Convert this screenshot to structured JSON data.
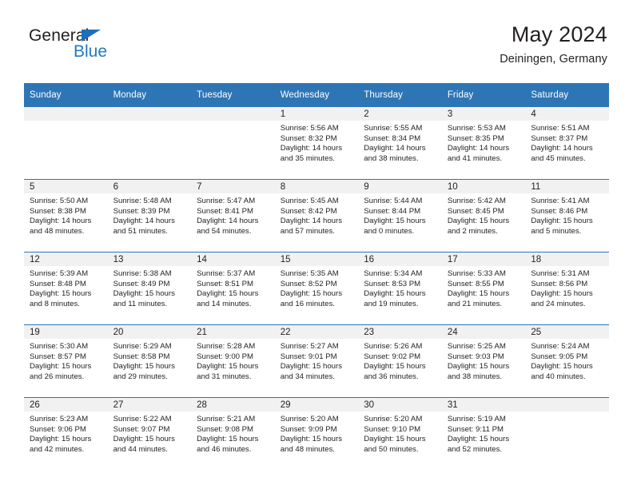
{
  "brand": {
    "name_part1": "General",
    "name_part2": "Blue",
    "accent_color": "#1f7ac0"
  },
  "header": {
    "title": "May 2024",
    "subtitle": "Deiningen, Germany"
  },
  "theme": {
    "header_blue": "#2e75b6",
    "daynum_band": "#f1f1f1",
    "text": "#231f20"
  },
  "weekday_headers": [
    "Sunday",
    "Monday",
    "Tuesday",
    "Wednesday",
    "Thursday",
    "Friday",
    "Saturday"
  ],
  "weeks": [
    [
      {
        "day": "",
        "sunrise": "",
        "sunset": "",
        "daylight_line1": "",
        "daylight_line2": ""
      },
      {
        "day": "",
        "sunrise": "",
        "sunset": "",
        "daylight_line1": "",
        "daylight_line2": ""
      },
      {
        "day": "",
        "sunrise": "",
        "sunset": "",
        "daylight_line1": "",
        "daylight_line2": ""
      },
      {
        "day": "1",
        "sunrise": "Sunrise: 5:56 AM",
        "sunset": "Sunset: 8:32 PM",
        "daylight_line1": "Daylight: 14 hours",
        "daylight_line2": "and 35 minutes."
      },
      {
        "day": "2",
        "sunrise": "Sunrise: 5:55 AM",
        "sunset": "Sunset: 8:34 PM",
        "daylight_line1": "Daylight: 14 hours",
        "daylight_line2": "and 38 minutes."
      },
      {
        "day": "3",
        "sunrise": "Sunrise: 5:53 AM",
        "sunset": "Sunset: 8:35 PM",
        "daylight_line1": "Daylight: 14 hours",
        "daylight_line2": "and 41 minutes."
      },
      {
        "day": "4",
        "sunrise": "Sunrise: 5:51 AM",
        "sunset": "Sunset: 8:37 PM",
        "daylight_line1": "Daylight: 14 hours",
        "daylight_line2": "and 45 minutes."
      }
    ],
    [
      {
        "day": "5",
        "sunrise": "Sunrise: 5:50 AM",
        "sunset": "Sunset: 8:38 PM",
        "daylight_line1": "Daylight: 14 hours",
        "daylight_line2": "and 48 minutes."
      },
      {
        "day": "6",
        "sunrise": "Sunrise: 5:48 AM",
        "sunset": "Sunset: 8:39 PM",
        "daylight_line1": "Daylight: 14 hours",
        "daylight_line2": "and 51 minutes."
      },
      {
        "day": "7",
        "sunrise": "Sunrise: 5:47 AM",
        "sunset": "Sunset: 8:41 PM",
        "daylight_line1": "Daylight: 14 hours",
        "daylight_line2": "and 54 minutes."
      },
      {
        "day": "8",
        "sunrise": "Sunrise: 5:45 AM",
        "sunset": "Sunset: 8:42 PM",
        "daylight_line1": "Daylight: 14 hours",
        "daylight_line2": "and 57 minutes."
      },
      {
        "day": "9",
        "sunrise": "Sunrise: 5:44 AM",
        "sunset": "Sunset: 8:44 PM",
        "daylight_line1": "Daylight: 15 hours",
        "daylight_line2": "and 0 minutes."
      },
      {
        "day": "10",
        "sunrise": "Sunrise: 5:42 AM",
        "sunset": "Sunset: 8:45 PM",
        "daylight_line1": "Daylight: 15 hours",
        "daylight_line2": "and 2 minutes."
      },
      {
        "day": "11",
        "sunrise": "Sunrise: 5:41 AM",
        "sunset": "Sunset: 8:46 PM",
        "daylight_line1": "Daylight: 15 hours",
        "daylight_line2": "and 5 minutes."
      }
    ],
    [
      {
        "day": "12",
        "sunrise": "Sunrise: 5:39 AM",
        "sunset": "Sunset: 8:48 PM",
        "daylight_line1": "Daylight: 15 hours",
        "daylight_line2": "and 8 minutes."
      },
      {
        "day": "13",
        "sunrise": "Sunrise: 5:38 AM",
        "sunset": "Sunset: 8:49 PM",
        "daylight_line1": "Daylight: 15 hours",
        "daylight_line2": "and 11 minutes."
      },
      {
        "day": "14",
        "sunrise": "Sunrise: 5:37 AM",
        "sunset": "Sunset: 8:51 PM",
        "daylight_line1": "Daylight: 15 hours",
        "daylight_line2": "and 14 minutes."
      },
      {
        "day": "15",
        "sunrise": "Sunrise: 5:35 AM",
        "sunset": "Sunset: 8:52 PM",
        "daylight_line1": "Daylight: 15 hours",
        "daylight_line2": "and 16 minutes."
      },
      {
        "day": "16",
        "sunrise": "Sunrise: 5:34 AM",
        "sunset": "Sunset: 8:53 PM",
        "daylight_line1": "Daylight: 15 hours",
        "daylight_line2": "and 19 minutes."
      },
      {
        "day": "17",
        "sunrise": "Sunrise: 5:33 AM",
        "sunset": "Sunset: 8:55 PM",
        "daylight_line1": "Daylight: 15 hours",
        "daylight_line2": "and 21 minutes."
      },
      {
        "day": "18",
        "sunrise": "Sunrise: 5:31 AM",
        "sunset": "Sunset: 8:56 PM",
        "daylight_line1": "Daylight: 15 hours",
        "daylight_line2": "and 24 minutes."
      }
    ],
    [
      {
        "day": "19",
        "sunrise": "Sunrise: 5:30 AM",
        "sunset": "Sunset: 8:57 PM",
        "daylight_line1": "Daylight: 15 hours",
        "daylight_line2": "and 26 minutes."
      },
      {
        "day": "20",
        "sunrise": "Sunrise: 5:29 AM",
        "sunset": "Sunset: 8:58 PM",
        "daylight_line1": "Daylight: 15 hours",
        "daylight_line2": "and 29 minutes."
      },
      {
        "day": "21",
        "sunrise": "Sunrise: 5:28 AM",
        "sunset": "Sunset: 9:00 PM",
        "daylight_line1": "Daylight: 15 hours",
        "daylight_line2": "and 31 minutes."
      },
      {
        "day": "22",
        "sunrise": "Sunrise: 5:27 AM",
        "sunset": "Sunset: 9:01 PM",
        "daylight_line1": "Daylight: 15 hours",
        "daylight_line2": "and 34 minutes."
      },
      {
        "day": "23",
        "sunrise": "Sunrise: 5:26 AM",
        "sunset": "Sunset: 9:02 PM",
        "daylight_line1": "Daylight: 15 hours",
        "daylight_line2": "and 36 minutes."
      },
      {
        "day": "24",
        "sunrise": "Sunrise: 5:25 AM",
        "sunset": "Sunset: 9:03 PM",
        "daylight_line1": "Daylight: 15 hours",
        "daylight_line2": "and 38 minutes."
      },
      {
        "day": "25",
        "sunrise": "Sunrise: 5:24 AM",
        "sunset": "Sunset: 9:05 PM",
        "daylight_line1": "Daylight: 15 hours",
        "daylight_line2": "and 40 minutes."
      }
    ],
    [
      {
        "day": "26",
        "sunrise": "Sunrise: 5:23 AM",
        "sunset": "Sunset: 9:06 PM",
        "daylight_line1": "Daylight: 15 hours",
        "daylight_line2": "and 42 minutes."
      },
      {
        "day": "27",
        "sunrise": "Sunrise: 5:22 AM",
        "sunset": "Sunset: 9:07 PM",
        "daylight_line1": "Daylight: 15 hours",
        "daylight_line2": "and 44 minutes."
      },
      {
        "day": "28",
        "sunrise": "Sunrise: 5:21 AM",
        "sunset": "Sunset: 9:08 PM",
        "daylight_line1": "Daylight: 15 hours",
        "daylight_line2": "and 46 minutes."
      },
      {
        "day": "29",
        "sunrise": "Sunrise: 5:20 AM",
        "sunset": "Sunset: 9:09 PM",
        "daylight_line1": "Daylight: 15 hours",
        "daylight_line2": "and 48 minutes."
      },
      {
        "day": "30",
        "sunrise": "Sunrise: 5:20 AM",
        "sunset": "Sunset: 9:10 PM",
        "daylight_line1": "Daylight: 15 hours",
        "daylight_line2": "and 50 minutes."
      },
      {
        "day": "31",
        "sunrise": "Sunrise: 5:19 AM",
        "sunset": "Sunset: 9:11 PM",
        "daylight_line1": "Daylight: 15 hours",
        "daylight_line2": "and 52 minutes."
      },
      {
        "day": "",
        "sunrise": "",
        "sunset": "",
        "daylight_line1": "",
        "daylight_line2": ""
      }
    ]
  ]
}
